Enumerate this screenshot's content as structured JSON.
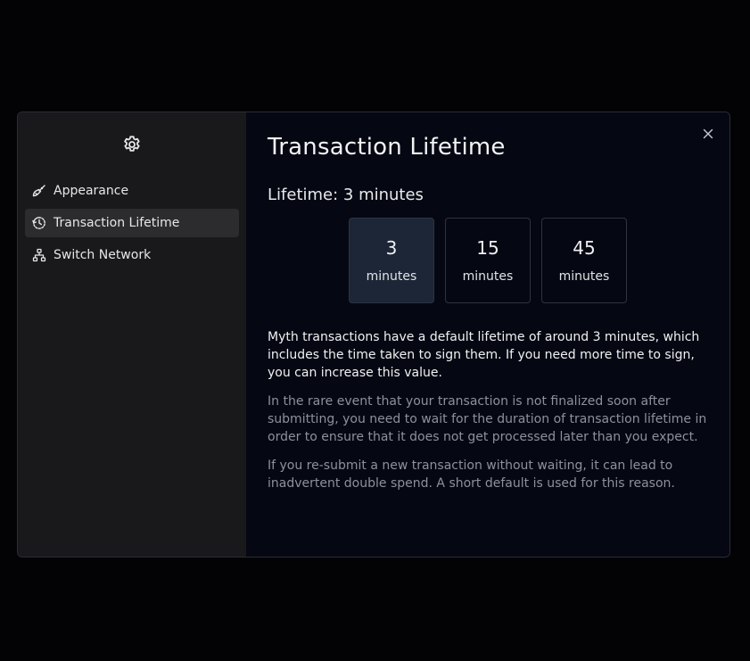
{
  "sidebar": {
    "items": [
      {
        "label": "Appearance",
        "icon": "brush-icon",
        "active": false
      },
      {
        "label": "Transaction Lifetime",
        "icon": "clock-history-icon",
        "active": true
      },
      {
        "label": "Switch Network",
        "icon": "network-icon",
        "active": false
      }
    ]
  },
  "main": {
    "title": "Transaction Lifetime",
    "subtitle": "Lifetime: 3 minutes",
    "options": [
      {
        "value": "3",
        "unit": "minutes",
        "selected": true
      },
      {
        "value": "15",
        "unit": "minutes",
        "selected": false
      },
      {
        "value": "45",
        "unit": "minutes",
        "selected": false
      }
    ],
    "paragraphs": [
      "Myth transactions have a default lifetime of around 3 minutes, which includes the time taken to sign them. If you need more time to sign, you can increase this value.",
      "In the rare event that your transaction is not finalized soon after submitting, you need to wait for the duration of transaction lifetime in order to ensure that it does not get processed later than you expect.",
      "If you re-submit a new transaction without waiting, it can lead to inadvertent double spend. A short default is used for this reason."
    ]
  },
  "colors": {
    "background": "#030306",
    "sidebar": "#19191b",
    "panel": "#050812",
    "selected_option": "#1d2636",
    "muted_text": "#8d919b"
  }
}
